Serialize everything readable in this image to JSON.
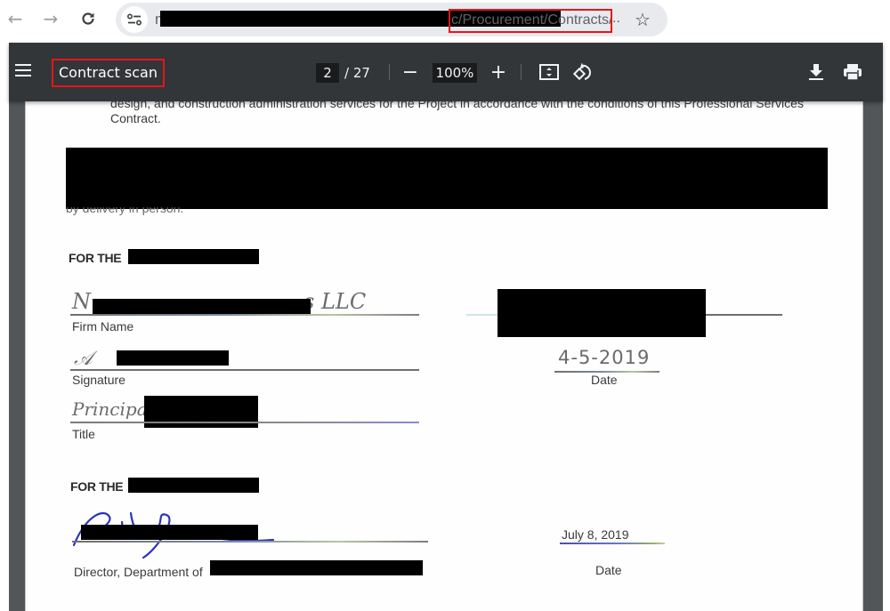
{
  "browser": {
    "back_icon": "arrow-left-icon",
    "forward_icon": "arrow-right-icon",
    "reload_icon": "reload-icon",
    "site_info_icon": "tune-icon",
    "url_prefix": "n",
    "url_path": "c/Procurement/Contracts/",
    "url_ellipsis": "..",
    "bookmark_icon": "star-icon"
  },
  "viewer": {
    "title": "Contract scan",
    "current_page": "2",
    "total_pages": "/ 27",
    "zoom_level": "100%",
    "zoom_out_label": "−",
    "zoom_in_label": "+",
    "icons": {
      "menu": "hamburger-icon",
      "fit": "fit-to-page-icon",
      "rotate": "rotate-icon",
      "download": "download-icon",
      "print": "print-icon"
    }
  },
  "document": {
    "top_paragraph_line1": "design, and construction administration services for the Project in accordance with the conditions of this Professional Services",
    "top_paragraph_line2": "Contract.",
    "faded_fragment": "by delivery in person.",
    "party1": {
      "heading": "FOR THE",
      "firm_name_handwritten_start": "N",
      "firm_name_handwritten_end": "s LLC",
      "firm_name_label": "Firm Name",
      "signature_label": "Signature",
      "title_handwritten": "Principal",
      "title_label": "Title",
      "date_handwritten": "4-5-2019",
      "date_label": "Date"
    },
    "party2": {
      "heading": "FOR THE",
      "signer_title": "Director, Department of",
      "date_value": "July 8, 2019",
      "date_label": "Date"
    }
  }
}
